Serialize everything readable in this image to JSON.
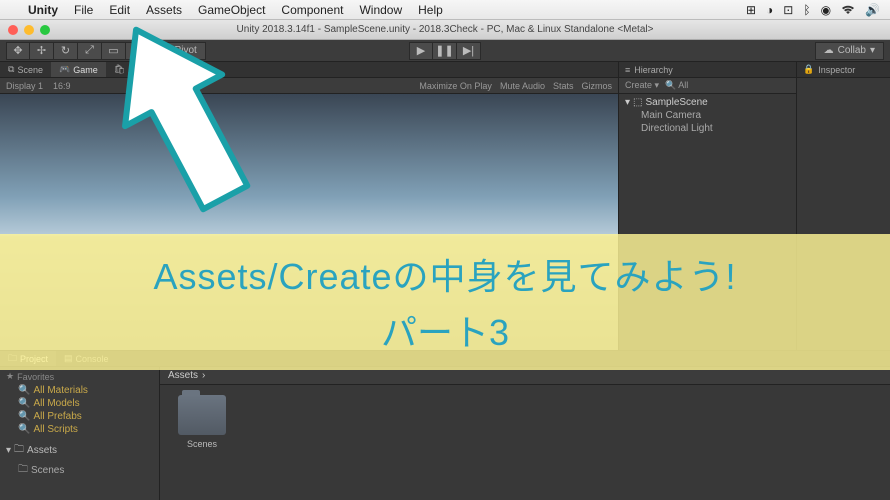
{
  "menubar": {
    "app": "Unity",
    "items": [
      "File",
      "Edit",
      "Assets",
      "GameObject",
      "Component",
      "Window",
      "Help"
    ]
  },
  "titlebar": {
    "title": "Unity 2018.3.14f1 - SampleScene.unity - 2018.3Check - PC, Mac & Linux Standalone <Metal>"
  },
  "toolbar": {
    "pivot_label": "Pivot",
    "collab_label": "Collab"
  },
  "scene_tabs": {
    "scene": "Scene",
    "game": "Game",
    "asset_store": "Asset Store"
  },
  "game_bar": {
    "display": "Display 1",
    "aspect": "16:9",
    "right": [
      "Maximize On Play",
      "Mute Audio",
      "Stats",
      "Gizmos"
    ]
  },
  "hierarchy": {
    "title": "Hierarchy",
    "create": "Create",
    "search": "All",
    "scene": "SampleScene",
    "items": [
      "Main Camera",
      "Directional Light"
    ]
  },
  "inspector": {
    "title": "Inspector"
  },
  "project": {
    "tab_project": "Project",
    "tab_console": "Console",
    "favorites": "Favorites",
    "fav_items": [
      "All Materials",
      "All Models",
      "All Prefabs",
      "All Scripts"
    ],
    "assets": "Assets",
    "assets_items": [
      "Scenes"
    ],
    "breadcrumb": "Assets",
    "folder_scenes": "Scenes"
  },
  "overlay": {
    "line1": "Assets/Createの中身を見てみよう!",
    "line2": "パート3"
  }
}
